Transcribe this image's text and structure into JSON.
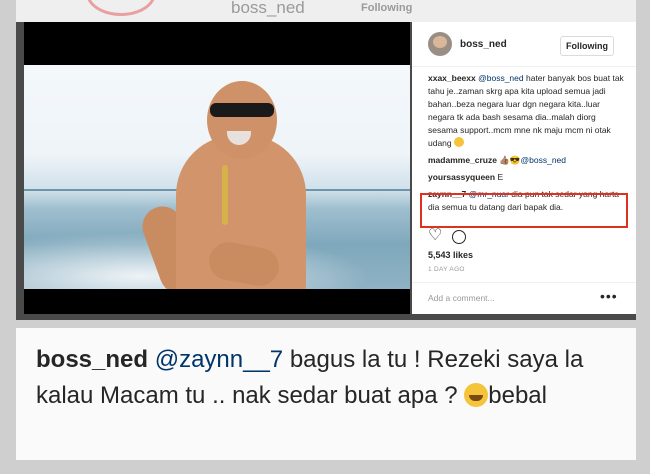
{
  "background_page": {
    "username": "boss_ned",
    "button_label": "Following"
  },
  "post": {
    "header": {
      "username": "boss_ned",
      "follow_label": "Following"
    },
    "comments": [
      {
        "user": "xxax_beexx",
        "mention": "@boss_ned",
        "text": " hater banyak bos buat tak tahu je..zaman skrg apa kita upload semua jadi bahan..beza negara luar dgn negara kita..luar negara tk ada bash sesama dia..malah diorg sesama support..mcm mne nk maju mcm ni otak udang "
      },
      {
        "user": "madamme_cruze",
        "mention": "@boss_ned",
        "text": " 👍🏽😎"
      },
      {
        "user": "yoursassyqueen",
        "mention": "",
        "text": " E"
      },
      {
        "user": "zaynn__7",
        "mention": "@mr_nuar",
        "text": " dia pun tak sedar yang harta dia semua tu datang dari bapak dia."
      }
    ],
    "likes": "5,543 likes",
    "timestamp": "1 DAY AGO",
    "add_comment_placeholder": "Add a comment...",
    "more_label": "•••"
  },
  "reply": {
    "user": "boss_ned",
    "mention": "@zaynn__7",
    "text": " bagus la tu ! Rezeki saya la kalau Macam tu .. nak sedar buat apa ? ",
    "tail": "bebal"
  },
  "icons": {
    "heart": "heart-icon",
    "comment": "comment-icon",
    "laughing_emoji": "laughing-emoji-icon"
  }
}
